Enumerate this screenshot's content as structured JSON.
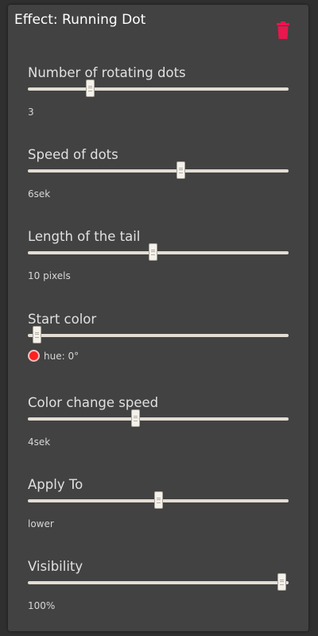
{
  "header": {
    "title": "Effect: Running Dot",
    "delete_icon": "trash-icon",
    "delete_color": "#e8174e"
  },
  "settings": [
    {
      "label": "Number of rotating dots",
      "value": "3",
      "level": 0.23
    },
    {
      "label": "Speed of dots",
      "value": "6sek",
      "level": 0.59
    },
    {
      "label": "Length of the tail",
      "value": "10 pixels",
      "level": 0.48
    },
    {
      "label": "Start color",
      "value": "hue: 0°",
      "level": 0.02,
      "swatch": "#ff2020"
    },
    {
      "label": "Color change speed",
      "value": "4sek",
      "level": 0.41
    },
    {
      "label": "Apply To",
      "value": "lower",
      "level": 0.5
    },
    {
      "label": "Visibility",
      "value": "100%",
      "level": 0.99
    }
  ]
}
